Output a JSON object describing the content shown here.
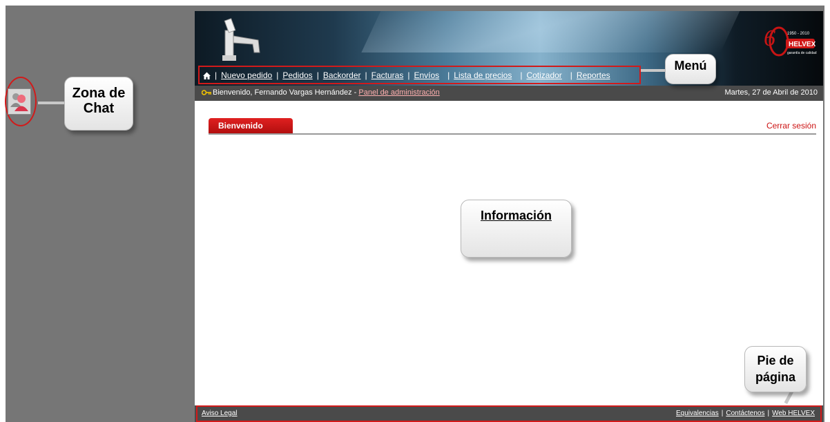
{
  "menu": {
    "items": [
      "Nuevo pedido",
      "Pedidos",
      "Backorder",
      "Facturas",
      "Envíos",
      "Lista de precios",
      "Cotizador",
      "Reportes"
    ]
  },
  "welcome": {
    "prefix": "Bienvenido, Fernando Vargas Hernández - ",
    "admin_link": "Panel de administración",
    "date": "Martes, 27 de Abril de 2010"
  },
  "tab": {
    "label": "Bienvenido"
  },
  "logout": {
    "label": "Cerrar sesión"
  },
  "footer": {
    "left_link": "Aviso Legal",
    "right_links": [
      "Equivalencias",
      "Contáctenos",
      "Web HELVEX"
    ]
  },
  "logo": {
    "brand": "HELVEX",
    "years": "1950 - 2010",
    "tagline": "garantía de calidad",
    "anniversary": "60"
  },
  "callouts": {
    "chat": "Zona de Chat",
    "menu": "Menú",
    "info": "Información",
    "footer": "Pie de página"
  },
  "colors": {
    "accent_red": "#d21a1a",
    "bar_gray": "#4a4a4a",
    "page_gray": "#767676"
  },
  "icons": {
    "home": "home-icon",
    "key": "key-icon",
    "chat": "chat-users-icon"
  }
}
